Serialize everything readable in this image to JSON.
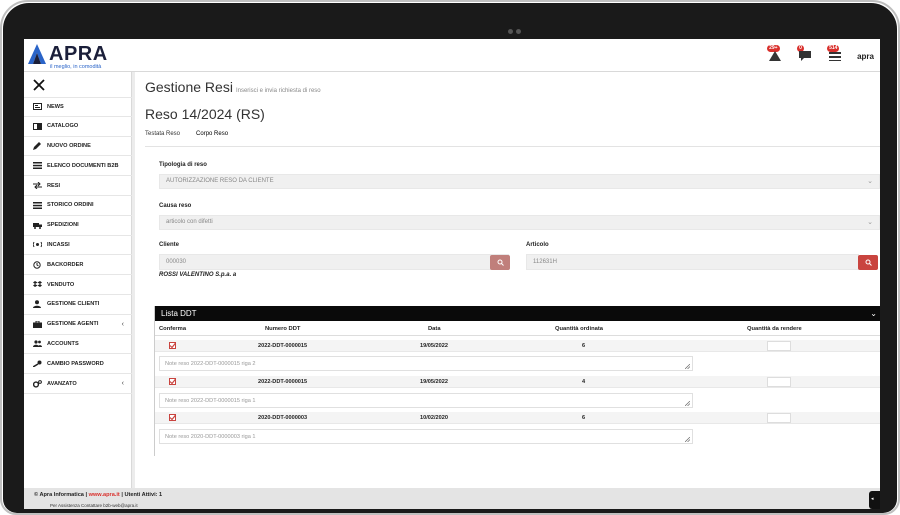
{
  "app": {
    "brand": "APRA",
    "tagline": "il meglio, in comodità"
  },
  "topbar": {
    "badges": {
      "alerts": "29+",
      "messages": "0",
      "cart": "514"
    },
    "user": "apra"
  },
  "sidebar": {
    "items": [
      {
        "label": "NEWS",
        "icon": "newspaper-icon"
      },
      {
        "label": "CATALOGO",
        "icon": "catalog-icon"
      },
      {
        "label": "NUOVO ORDINE",
        "icon": "pencil-icon"
      },
      {
        "label": "ELENCO DOCUMENTI B2B",
        "icon": "list-icon"
      },
      {
        "label": "RESI",
        "icon": "exchange-icon"
      },
      {
        "label": "STORICO ORDINI",
        "icon": "list-icon"
      },
      {
        "label": "SPEDIZIONI",
        "icon": "truck-icon"
      },
      {
        "label": "INCASSI",
        "icon": "money-icon"
      },
      {
        "label": "BACKORDER",
        "icon": "history-icon"
      },
      {
        "label": "VENDUTO",
        "icon": "dropbox-icon"
      },
      {
        "label": "GESTIONE CLIENTI",
        "icon": "user-icon"
      },
      {
        "label": "GESTIONE AGENTI",
        "icon": "briefcase-icon",
        "chevron": "‹"
      },
      {
        "label": "ACCOUNTS",
        "icon": "users-icon"
      },
      {
        "label": "CAMBIO PASSWORD",
        "icon": "key-icon"
      },
      {
        "label": "AVANZATO",
        "icon": "cogs-icon",
        "chevron": "‹"
      }
    ]
  },
  "page": {
    "title": "Gestione Resi",
    "subtitle": "Inserisci e invia richiesta di reso",
    "document": "Reso 14/2024 (RS)",
    "tabs": [
      "Testata Reso",
      "Corpo Reso"
    ]
  },
  "form": {
    "tipologia_label": "Tipologia di reso",
    "tipologia_value": "AUTORIZZAZIONE RESO DA CLIENTE",
    "causa_label": "Causa reso",
    "causa_value": "articolo con difetti",
    "cliente_label": "Cliente",
    "cliente_value": "000030",
    "cliente_name": "ROSSI VALENTINO S.p.a. a",
    "articolo_label": "Articolo",
    "articolo_value": "112631H"
  },
  "ddt": {
    "title": "Lista DDT",
    "columns": {
      "conferma": "Conferma",
      "numero": "Numero DDT",
      "data": "Data",
      "ordinata": "Quantità ordinata",
      "rendere": "Quantità da rendere"
    },
    "rows": [
      {
        "numero": "2022-DDT-0000015",
        "data": "19/05/2022",
        "qty": "6",
        "note": "Note reso 2022-DDT-0000015 riga 2"
      },
      {
        "numero": "2022-DDT-0000015",
        "data": "19/05/2022",
        "qty": "4",
        "note": "Note reso 2022-DDT-0000015 riga 1"
      },
      {
        "numero": "2020-DDT-0000003",
        "data": "10/02/2020",
        "qty": "6",
        "note": "Note reso 2020-DDT-0000003 riga 1"
      }
    ]
  },
  "footer": {
    "company": "© Apra Informatica | ",
    "site": "www.apra.it",
    "users": " | Utenti Attivi: 1",
    "support": "Per Assistenza Contattare b2b-web@apra.it"
  },
  "colors": {
    "accent_red": "#c9443f",
    "brand_navy": "#1b1f3a",
    "brand_blue": "#2a64c8"
  }
}
